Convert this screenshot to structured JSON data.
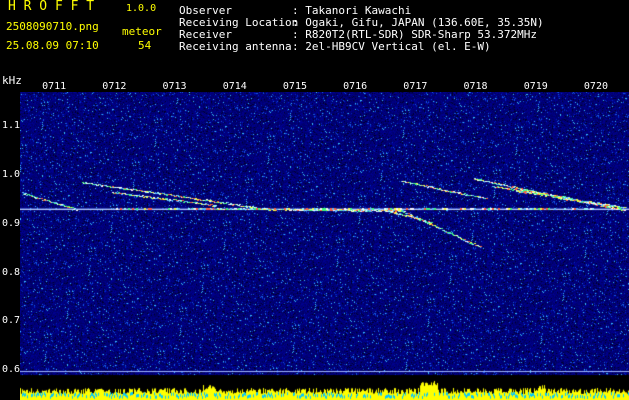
{
  "header": {
    "app_title": "H R O F F T",
    "app_version": "1.0.0",
    "filename": "2508090710.png",
    "meteor_label": "meteor",
    "datetime": "25.08.09 07:10",
    "meteor_count": "54"
  },
  "info": {
    "keys": "Observer\nReceiving Location\nReceiver\nReceiving antenna",
    "values": ": Takanori Kawachi\n: Ogaki, Gifu, JAPAN (136.60E, 35.35N)\n: R820T2(RTL-SDR) SDR-Sharp 53.372MHz\n: 2el-HB9CV Vertical (el. E-W)"
  },
  "chart_data": {
    "type": "heatmap",
    "title": "",
    "ylabel": "kHz",
    "xlabel": "",
    "x_ticks": [
      "0711",
      "0712",
      "0713",
      "0714",
      "0715",
      "0716",
      "0717",
      "0718",
      "0719",
      "0720"
    ],
    "y_ticks": [
      "1.1",
      "1.0",
      "0.9",
      "0.8",
      "0.7",
      "0.6"
    ],
    "y_tick_values": [
      1.1,
      1.0,
      0.9,
      0.8,
      0.7,
      0.6
    ],
    "ylim": [
      0.59,
      1.17
    ],
    "carrier_khz": 0.93,
    "echo_traces": [
      {
        "t0": 0.0,
        "t1": 0.9,
        "f0": 0.963,
        "f1": 0.93
      },
      {
        "t0": 1.0,
        "t1": 4.2,
        "f0": 0.985,
        "f1": 0.928
      },
      {
        "t0": 1.5,
        "t1": 3.2,
        "f0": 0.965,
        "f1": 0.938
      },
      {
        "t0": 2.8,
        "t1": 6.3,
        "f0": 0.932,
        "f1": 0.927
      },
      {
        "t0": 6.0,
        "t1": 6.8,
        "f0": 0.93,
        "f1": 0.903
      },
      {
        "t0": 6.3,
        "t1": 7.6,
        "f0": 0.927,
        "f1": 0.853
      },
      {
        "t0": 6.3,
        "t1": 7.7,
        "f0": 0.988,
        "f1": 0.952
      },
      {
        "t0": 7.5,
        "t1": 10.0,
        "f0": 0.993,
        "f1": 0.928
      },
      {
        "t0": 7.8,
        "t1": 9.1,
        "f0": 0.977,
        "f1": 0.953
      },
      {
        "t0": 8.2,
        "t1": 10.0,
        "f0": 0.968,
        "f1": 0.934
      },
      {
        "t0": 8.8,
        "t1": 9.9,
        "f0": 0.955,
        "f1": 0.935
      },
      {
        "t0": 4.5,
        "t1": 6.2,
        "f0": 0.929,
        "f1": 0.928
      }
    ]
  },
  "colors": {
    "background": "#000000",
    "noise": "#000080",
    "carrier": "#c8d8ff",
    "header_text": "#ffff00",
    "info_text": "#ffffff",
    "power_bar": "#ffff00",
    "power_base": "#00c8ff"
  }
}
